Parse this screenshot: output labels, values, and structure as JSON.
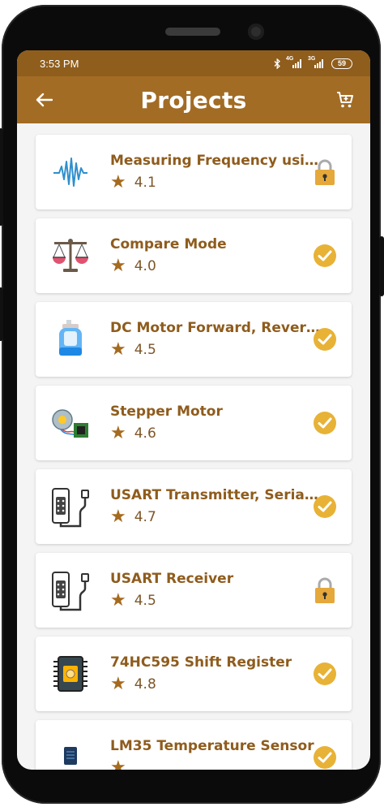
{
  "status_bar": {
    "time": "3:53 PM",
    "net1": "4G",
    "net2": "3G",
    "battery": "59"
  },
  "app_bar": {
    "title": "Projects",
    "back_icon": "arrow-left-icon",
    "cart_icon": "cart-icon"
  },
  "colors": {
    "status_bar": "#8f5d1c",
    "app_bar": "#a26c25",
    "title_text": "#8f5c1d",
    "check": "#e8b236",
    "lock": "#e5a83a"
  },
  "projects": [
    {
      "title": "Measuring Frequency using …",
      "rating": "4.1",
      "status": "locked",
      "icon": "waveform-icon"
    },
    {
      "title": "Compare Mode",
      "rating": "4.0",
      "status": "completed",
      "icon": "balance-scale-icon"
    },
    {
      "title": "DC Motor Forward, Reverse, …",
      "rating": "4.5",
      "status": "completed",
      "icon": "dc-motor-icon"
    },
    {
      "title": "Stepper Motor",
      "rating": "4.6",
      "status": "completed",
      "icon": "stepper-motor-icon"
    },
    {
      "title": "USART Transmitter, Serial …",
      "rating": "4.7",
      "status": "completed",
      "icon": "serial-connector-icon"
    },
    {
      "title": "USART Receiver",
      "rating": "4.5",
      "status": "locked",
      "icon": "serial-connector-icon"
    },
    {
      "title": "74HC595 Shift Register",
      "rating": "4.8",
      "status": "completed",
      "icon": "chip-icon"
    },
    {
      "title": "LM35 Temperature Sensor",
      "rating": "",
      "status": "completed",
      "icon": "temperature-sensor-icon"
    }
  ]
}
